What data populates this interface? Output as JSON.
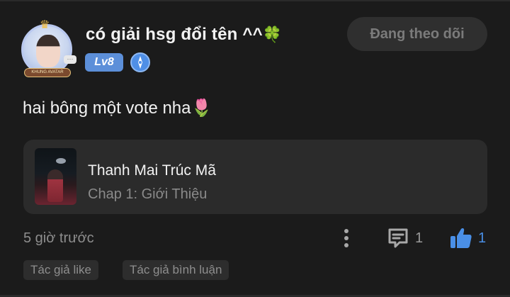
{
  "header": {
    "username": "có giải hsg đổi tên ^^",
    "username_emoji": "🍀",
    "level": "Lv8",
    "avatar_banner_text": "KHUNG AVATAR",
    "rank_icon": "compass-badge-icon",
    "follow_label": "Đang theo dõi"
  },
  "comment": {
    "text": "hai bông một vote nha",
    "emoji": "🌷"
  },
  "chapter": {
    "title": "Thanh Mai Trúc Mã",
    "subtitle": "Chap 1: Giới Thiệu"
  },
  "footer": {
    "timestamp": "5 giờ trước",
    "comment_count": "1",
    "like_count": "1"
  },
  "tags": {
    "author_like": "Tác giả like",
    "author_comment": "Tác giả bình luận"
  },
  "colors": {
    "background": "#1b1b1b",
    "card": "#2b2b2b",
    "accent_blue": "#4a8fe6",
    "level_badge": "#5c8fd9",
    "muted_text": "#8e8e8e"
  }
}
